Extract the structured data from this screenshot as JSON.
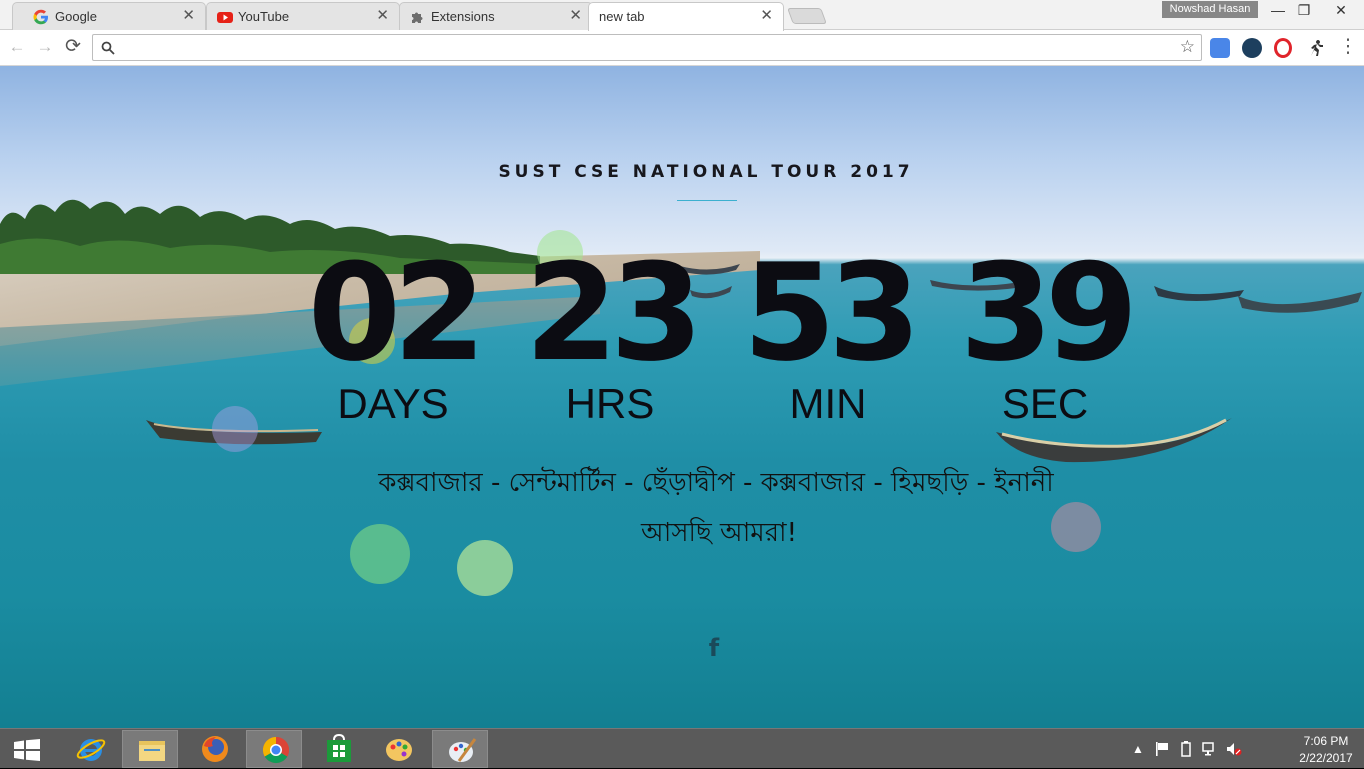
{
  "browser": {
    "tabs": [
      {
        "title": "Google",
        "icon": "google-icon",
        "active": false
      },
      {
        "title": "YouTube",
        "icon": "youtube-icon",
        "active": false
      },
      {
        "title": "Extensions",
        "icon": "puzzle-icon",
        "active": false
      },
      {
        "title": "new tab",
        "icon": "",
        "active": true
      }
    ],
    "close_glyph": "✕",
    "profile_name": "Nowshad Hasan",
    "window_buttons": {
      "minimize": "—",
      "restore": "❐",
      "close": "✕"
    },
    "omnibox": {
      "value": "",
      "placeholder": ""
    },
    "nav": {
      "back": "←",
      "forward": "→",
      "reload": "⟳",
      "star": "☆",
      "menu": "⋮"
    }
  },
  "page": {
    "title": "SUST CSE NATIONAL TOUR 2017",
    "countdown": [
      {
        "value": "02",
        "label": "DAYS"
      },
      {
        "value": "23",
        "label": "HRS"
      },
      {
        "value": "53",
        "label": "MIN"
      },
      {
        "value": "39",
        "label": "SEC"
      }
    ],
    "route": "কক্সবাজার - সেন্টমার্টিন - ছেঁড়াদ্বীপ - কক্সবাজার - হিমছড়ি - ইনানী",
    "tagline": "আসছি আমরা!",
    "social": {
      "facebook": "f"
    }
  },
  "taskbar": {
    "apps": [
      "start",
      "internet-explorer",
      "file-explorer",
      "firefox",
      "chrome",
      "store",
      "paint",
      "paint-alt"
    ],
    "active_apps": [
      "chrome",
      "paint-alt"
    ],
    "clock": {
      "time": "7:06 PM",
      "date": "2/22/2017"
    },
    "tray_icons": [
      "show-hidden-icon",
      "flag-icon",
      "power-icon",
      "network-icon",
      "volume-muted-icon"
    ]
  },
  "colors": {
    "accent_rule": "#3cb0cf",
    "taskbar": "#5a5a5a",
    "youtube": "#e62117"
  }
}
